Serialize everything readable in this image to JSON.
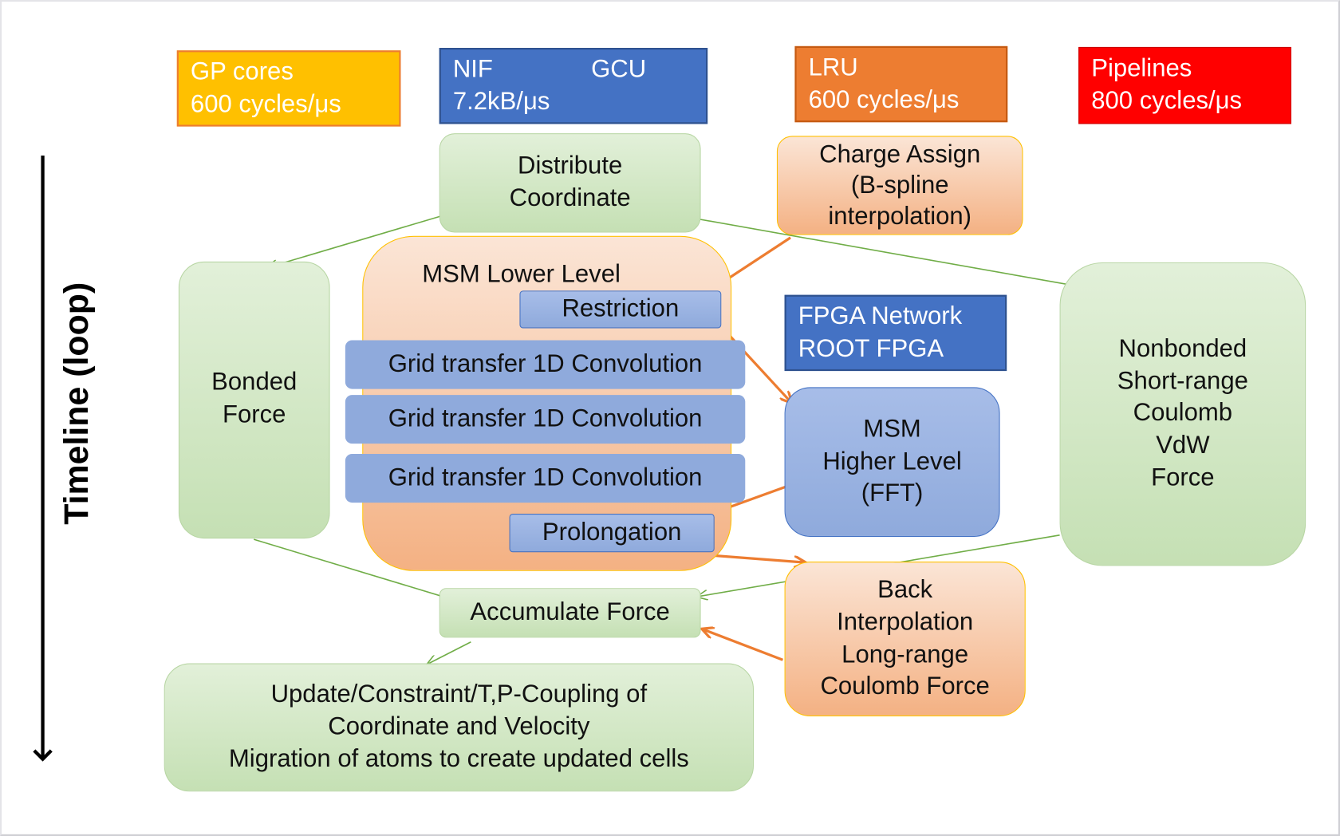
{
  "timeline_label": "Timeline (loop)",
  "headers": {
    "gp": {
      "line1": "GP cores",
      "line2": "600 cycles/μs",
      "color": "#FFC000"
    },
    "nif": {
      "line1a": "NIF",
      "line1b": "GCU",
      "line2": "7.2kB/μs",
      "color": "#4472C4"
    },
    "lru": {
      "line1": "LRU",
      "line2": "600 cycles/μs",
      "color": "#ED7D31"
    },
    "pipelines": {
      "line1": "Pipelines",
      "line2": "800 cycles/μs",
      "color": "#FF0000"
    },
    "fpga": {
      "line1": "FPGA Network",
      "line2": "ROOT FPGA",
      "color": "#4472C4"
    }
  },
  "nodes": {
    "distribute": [
      "Distribute",
      "Coordinate"
    ],
    "charge_assign": [
      "Charge Assign",
      "(B-spline",
      "interpolation)"
    ],
    "msm_lower": "MSM Lower Level",
    "restriction": "Restriction",
    "grid_rows": [
      "Grid transfer 1D Convolution",
      "Grid transfer 1D Convolution",
      "Grid transfer 1D Convolution"
    ],
    "prolongation": "Prolongation",
    "msm_higher": [
      "MSM",
      "Higher Level",
      "(FFT)"
    ],
    "bonded": [
      "Bonded",
      "Force"
    ],
    "nonbonded": [
      "Nonbonded",
      "Short-range",
      "Coulomb",
      "VdW",
      "Force"
    ],
    "accumulate": "Accumulate Force",
    "back_interp": [
      "Back",
      "Interpolation",
      "Long-range",
      "Coulomb Force"
    ],
    "update": [
      "Update/Constraint/T,P-Coupling of",
      "Coordinate and Velocity",
      "Migration of atoms to create updated cells"
    ]
  },
  "colors": {
    "green_arrow": "#70AD47",
    "orange_arrow": "#ED7D31"
  }
}
